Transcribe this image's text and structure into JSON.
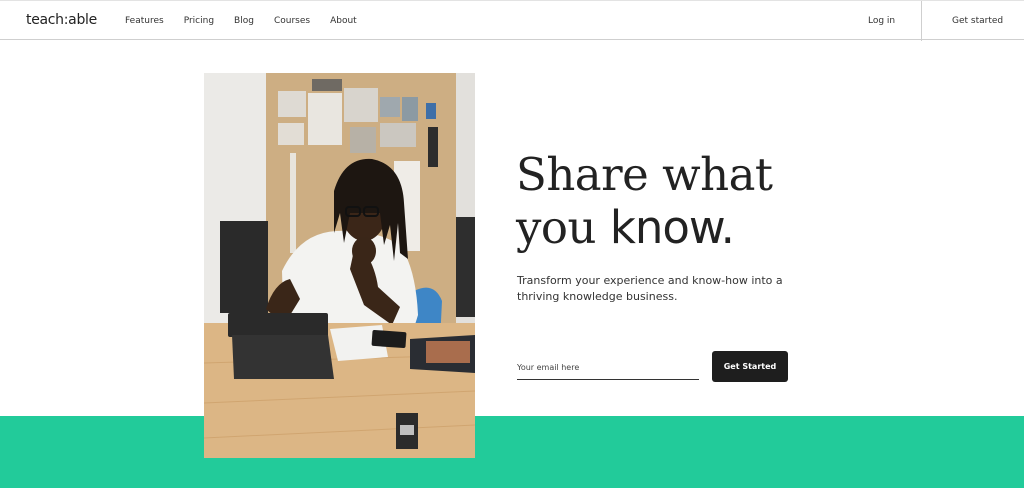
{
  "header": {
    "logo": "teach:able",
    "nav": [
      "Features",
      "Pricing",
      "Blog",
      "Courses",
      "About"
    ],
    "login_label": "Log in",
    "get_started_label": "Get started"
  },
  "hero": {
    "headline_line1": "Share what",
    "headline_line2_regular": "you ",
    "headline_line2_bold": "know.",
    "subtext": "Transform your experience and know-how into a thriving knowledge business.",
    "email_placeholder": "Your email here",
    "cta_label": "Get Started"
  },
  "colors": {
    "accent_green": "#22cb9a",
    "button_dark": "#1e1e1e"
  }
}
